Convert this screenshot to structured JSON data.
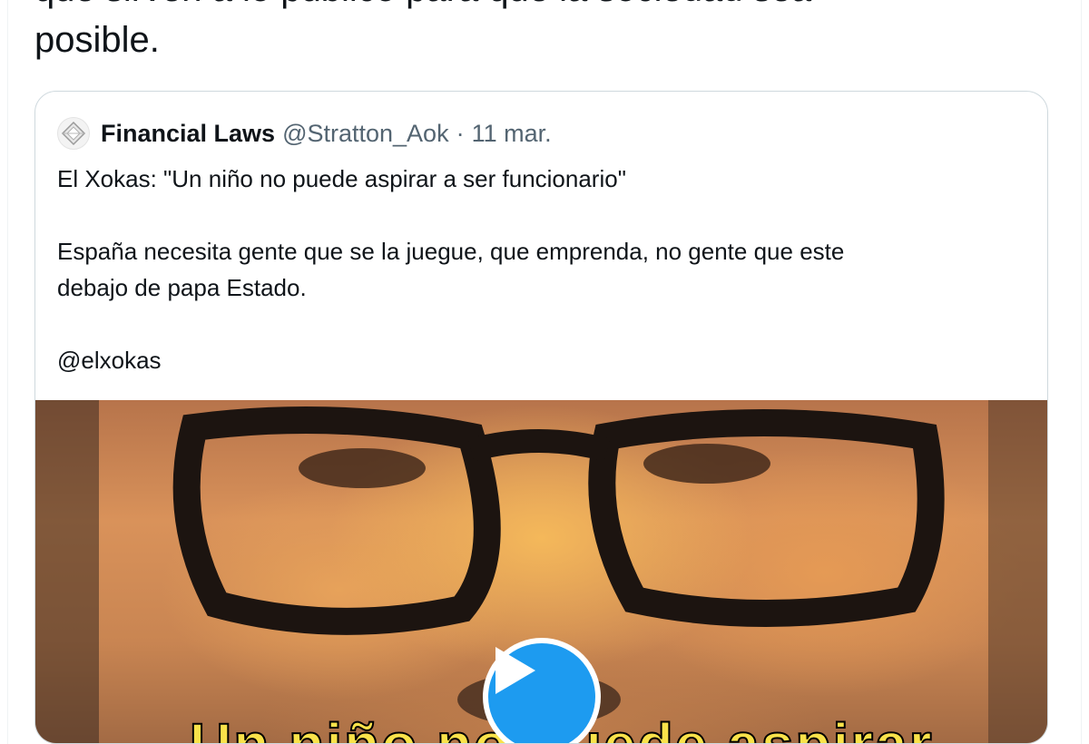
{
  "tweet": {
    "text_lines": [
      "que sirven a lo público para que la sociedad sea",
      "posible."
    ]
  },
  "quote": {
    "author_name": "Financial Laws",
    "author_handle": "@Stratton_Aok",
    "separator": "·",
    "date": "11 mar.",
    "avatar_icon": "diamond-logo-icon",
    "body": {
      "line1": "El Xokas: \"Un niño no puede aspirar a ser funcionario\"",
      "line2": "España necesita gente que se la juegue, que emprenda, no gente que este",
      "line3": "debajo de papa Estado.",
      "mention": "@elxokas"
    },
    "media": {
      "type": "video",
      "play_icon": "play-icon",
      "caption": "Un niño no puede aspirar",
      "accent_color": "#1d9bf0"
    }
  }
}
